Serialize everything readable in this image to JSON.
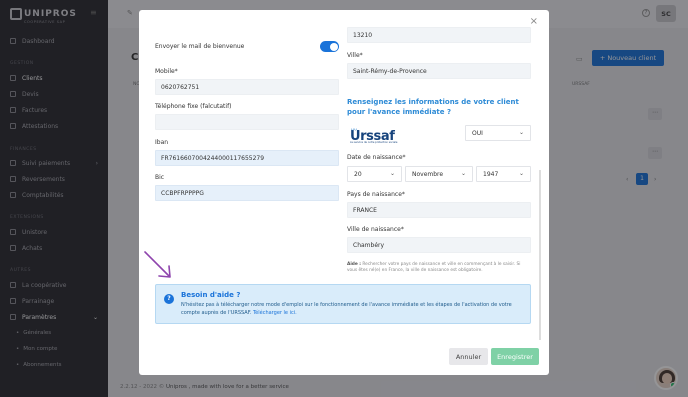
{
  "sidebar": {
    "logo_text": "UNIPROS",
    "logo_sub": "COOPERATIVE SAP",
    "sections": {
      "gestion": "GESTION",
      "finances": "FINANCES",
      "extensions": "EXTENSIONS",
      "autres": "AUTRES"
    },
    "items": {
      "dashboard": "Dashboard",
      "clients": "Clients",
      "devis": "Devis",
      "factures": "Factures",
      "attestations": "Attestations",
      "suivi_paiements": "Suivi paiements",
      "reversements": "Reversements",
      "comptabilites": "Comptabilités",
      "unistore": "Unistore",
      "achats": "Achats",
      "cooperative": "La coopérative",
      "parrainage": "Parrainage",
      "parametres": "Paramètres",
      "generales": "Générales",
      "mon_compte": "Mon compte",
      "abonnements": "Abonnements"
    }
  },
  "topbar": {
    "avatar_initials": "SC",
    "help_glyph": "?"
  },
  "background": {
    "page_title_initial": "C",
    "new_client_label": "+ Nouveau client",
    "col_no": "NO",
    "col_urssaf": "URSSAF",
    "page_current": "1",
    "page_prev": "‹",
    "page_next": "›"
  },
  "modal": {
    "close_glyph": "×",
    "welcome_label": "Envoyer le mail de bienvenue",
    "mobile_label": "Mobile*",
    "mobile_value": "0620762751",
    "phone_label": "Téléphone fixe (falcutatif)",
    "phone_value": "",
    "iban_label": "Iban",
    "iban_value": "FR7616607004244000117655279",
    "bic_label": "Bic",
    "bic_value": "CCBPFRPPPPG",
    "postal_value": "13210",
    "ville_label": "Ville*",
    "ville_value": "Saint-Rémy-de-Provence",
    "question": "Renseignez les informations de votre client pour l'avance immédiate ?",
    "urssaf_logo": "Urssaf",
    "urssaf_tagline": "Au service de notre protection sociale",
    "oui_value": "OUI",
    "dob_label": "Date de naissance*",
    "dob_day": "20",
    "dob_month": "Novembre",
    "dob_year": "1947",
    "country_label": "Pays de naissance*",
    "country_value": "FRANCE",
    "city_birth_label": "Ville de naissance*",
    "city_birth_value": "Chambéry",
    "aide_bold": "Aide :",
    "aide_text": " Rechercher votre pays de naissance et ville en commençant à le saisir. Si vous êtes né(e) en France, la ville de naissance est obligatoire.",
    "help_title": "Besoin d'aide ?",
    "help_text": "N'hésitez pas à télécharger notre mode d'emploi sur le fonctionnement de l'avance immédiate et les étapes de l'activation de votre compte auprès de l'URSSAF. ",
    "help_link": "Télécharger le ici.",
    "cancel_label": "Annuler",
    "save_label": "Enregistrer"
  },
  "footer": {
    "version": "2.2.12 - 2022 ©",
    "text": " Unipros , made with love for a better service"
  },
  "colors": {
    "primary": "#1a73d9",
    "save_green": "#7fd1a6",
    "sidebar_bg": "#2a2b31",
    "help_bg": "#d9ecfa",
    "arrow": "#8e44ad"
  }
}
